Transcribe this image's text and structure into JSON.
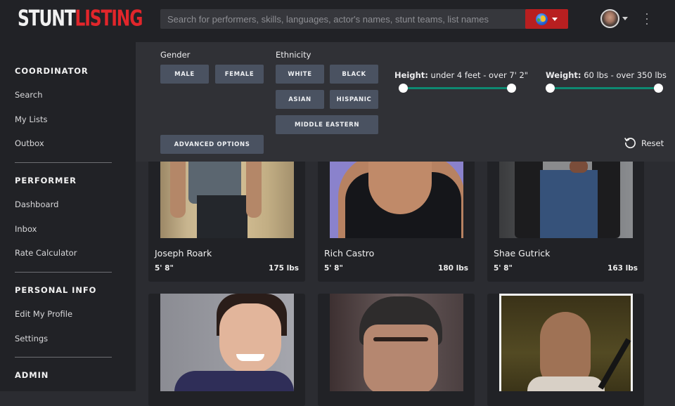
{
  "brand": {
    "logo_part1": "STUNT",
    "logo_part2": "LISTING"
  },
  "search": {
    "placeholder": "Search for performers, skills, languages, actor's names, stunt teams, list names",
    "value": "",
    "scope_icon": "globe-icon"
  },
  "header": {
    "avatar_icon": "user-avatar",
    "menu_icon": "kebab-menu-icon"
  },
  "sidebar": {
    "sections": [
      {
        "heading": "COORDINATOR",
        "items": [
          "Search",
          "My Lists",
          "Outbox"
        ]
      },
      {
        "heading": "PERFORMER",
        "items": [
          "Dashboard",
          "Inbox",
          "Rate Calculator"
        ]
      },
      {
        "heading": "PERSONAL INFO",
        "items": [
          "Edit My Profile",
          "Settings"
        ]
      },
      {
        "heading": "ADMIN",
        "items": []
      }
    ]
  },
  "filters": {
    "gender": {
      "label": "Gender",
      "options": [
        "MALE",
        "FEMALE"
      ]
    },
    "ethnicity": {
      "label": "Ethnicity",
      "options": [
        "WHITE",
        "BLACK",
        "ASIAN",
        "HISPANIC",
        "MIDDLE EASTERN"
      ]
    },
    "advanced_label": "ADVANCED OPTIONS",
    "height": {
      "label": "Height:",
      "range_text": "under 4 feet - over 7' 2\"",
      "min_pct": 0,
      "max_pct": 100
    },
    "weight": {
      "label": "Weight:",
      "range_text": "60 lbs - over 350 lbs",
      "min_pct": 0,
      "max_pct": 100
    },
    "reset_label": "Reset",
    "accent_color": "#0e8a72"
  },
  "performers": [
    {
      "name": "Joseph Roark",
      "height": "5' 8\"",
      "weight": "175 lbs"
    },
    {
      "name": "Rich Castro",
      "height": "5' 8\"",
      "weight": "180 lbs"
    },
    {
      "name": "Shae Gutrick",
      "height": "5' 8\"",
      "weight": "163 lbs"
    },
    {
      "name": "",
      "height": "",
      "weight": ""
    },
    {
      "name": "",
      "height": "",
      "weight": ""
    },
    {
      "name": "",
      "height": "",
      "weight": ""
    }
  ],
  "colors": {
    "brand_red": "#e1262b",
    "search_button": "#b81f20",
    "chip": "#4a5261"
  }
}
